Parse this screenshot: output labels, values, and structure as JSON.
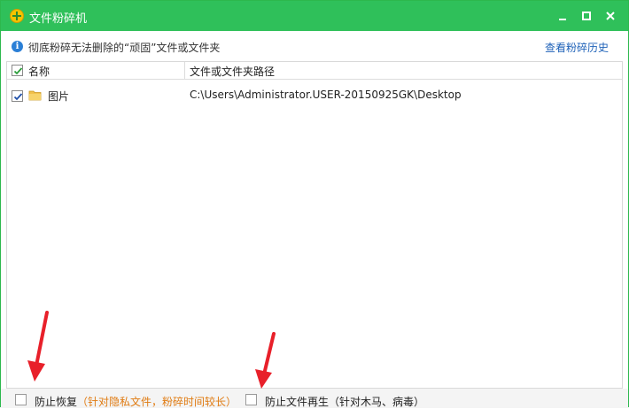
{
  "window": {
    "title": "文件粉碎机",
    "controls": [
      "minimize",
      "maximize",
      "close"
    ]
  },
  "info": {
    "text": "彻底粉碎无法删除的“顽固”文件或文件夹",
    "history_link": "查看粉碎历史"
  },
  "table": {
    "columns": [
      "名称",
      "文件或文件夹路径"
    ],
    "header_checked": true,
    "rows": [
      {
        "checked": true,
        "icon": "folder-icon",
        "name": "图片",
        "path": "C:\\Users\\Administrator.USER-20150925GK\\Desktop"
      }
    ]
  },
  "options": [
    {
      "label": "防止恢复",
      "hint": "（针对隐私文件，粉碎时间较长）",
      "checked": false
    },
    {
      "label": "防止文件再生",
      "hint": "（针对木马、病毒）",
      "checked": false
    }
  ],
  "colors": {
    "titlebar": "#2fc05a",
    "link": "#1f62b8",
    "hint": "#e07b12",
    "annotation_arrow": "#e8202a"
  }
}
